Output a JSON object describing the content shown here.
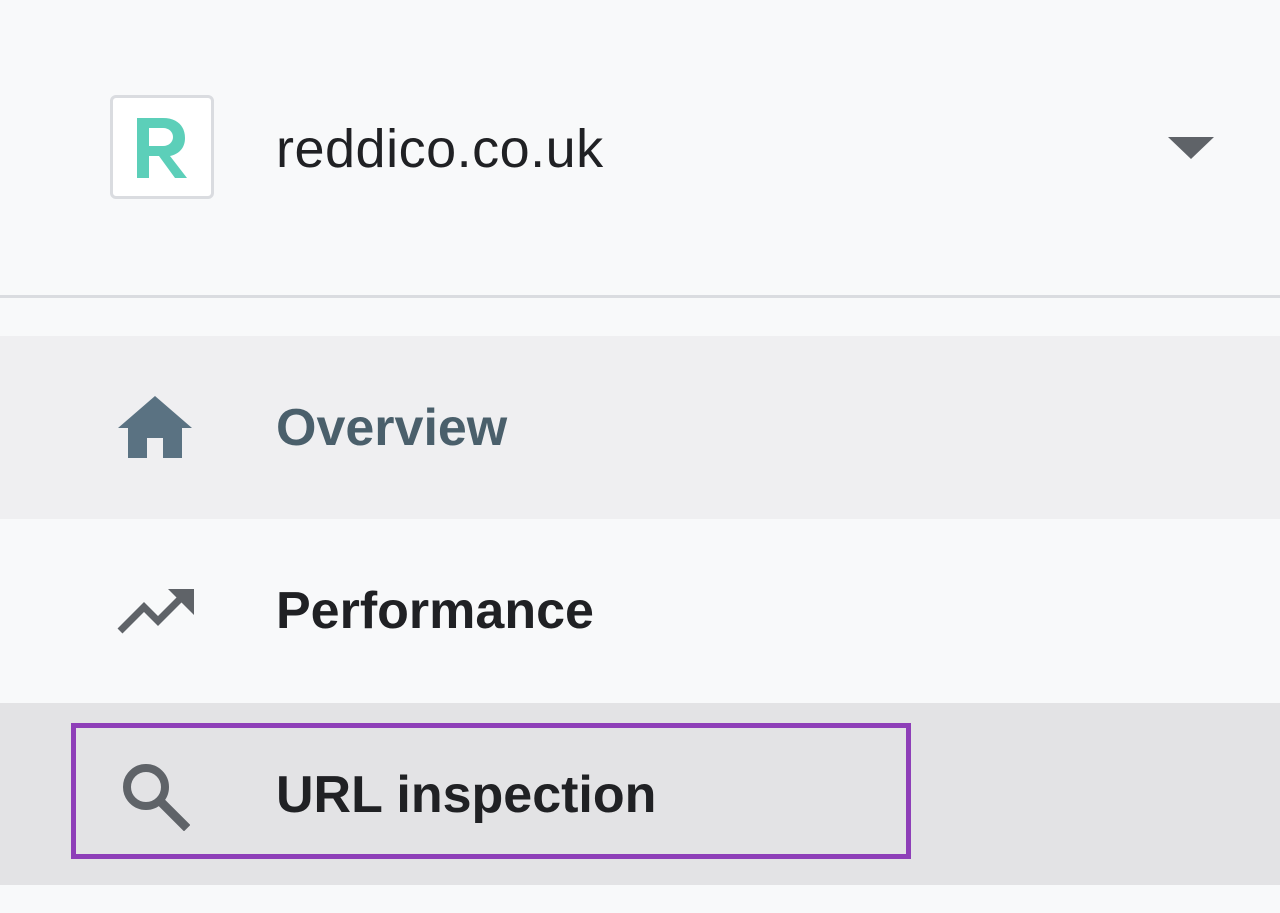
{
  "property": {
    "name": "reddico.co.uk",
    "logo_icon": "reddico-r-logo",
    "logo_color": "#5ccfb9"
  },
  "nav": {
    "items": [
      {
        "label": "Overview",
        "icon": "home-icon",
        "state": "active"
      },
      {
        "label": "Performance",
        "icon": "trending-up-icon",
        "state": "normal"
      },
      {
        "label": "URL inspection",
        "icon": "search-icon",
        "state": "hover-highlighted"
      }
    ]
  },
  "colors": {
    "highlight_border": "#8e3fb8",
    "active_text": "#4a5f6b",
    "text": "#202124"
  }
}
